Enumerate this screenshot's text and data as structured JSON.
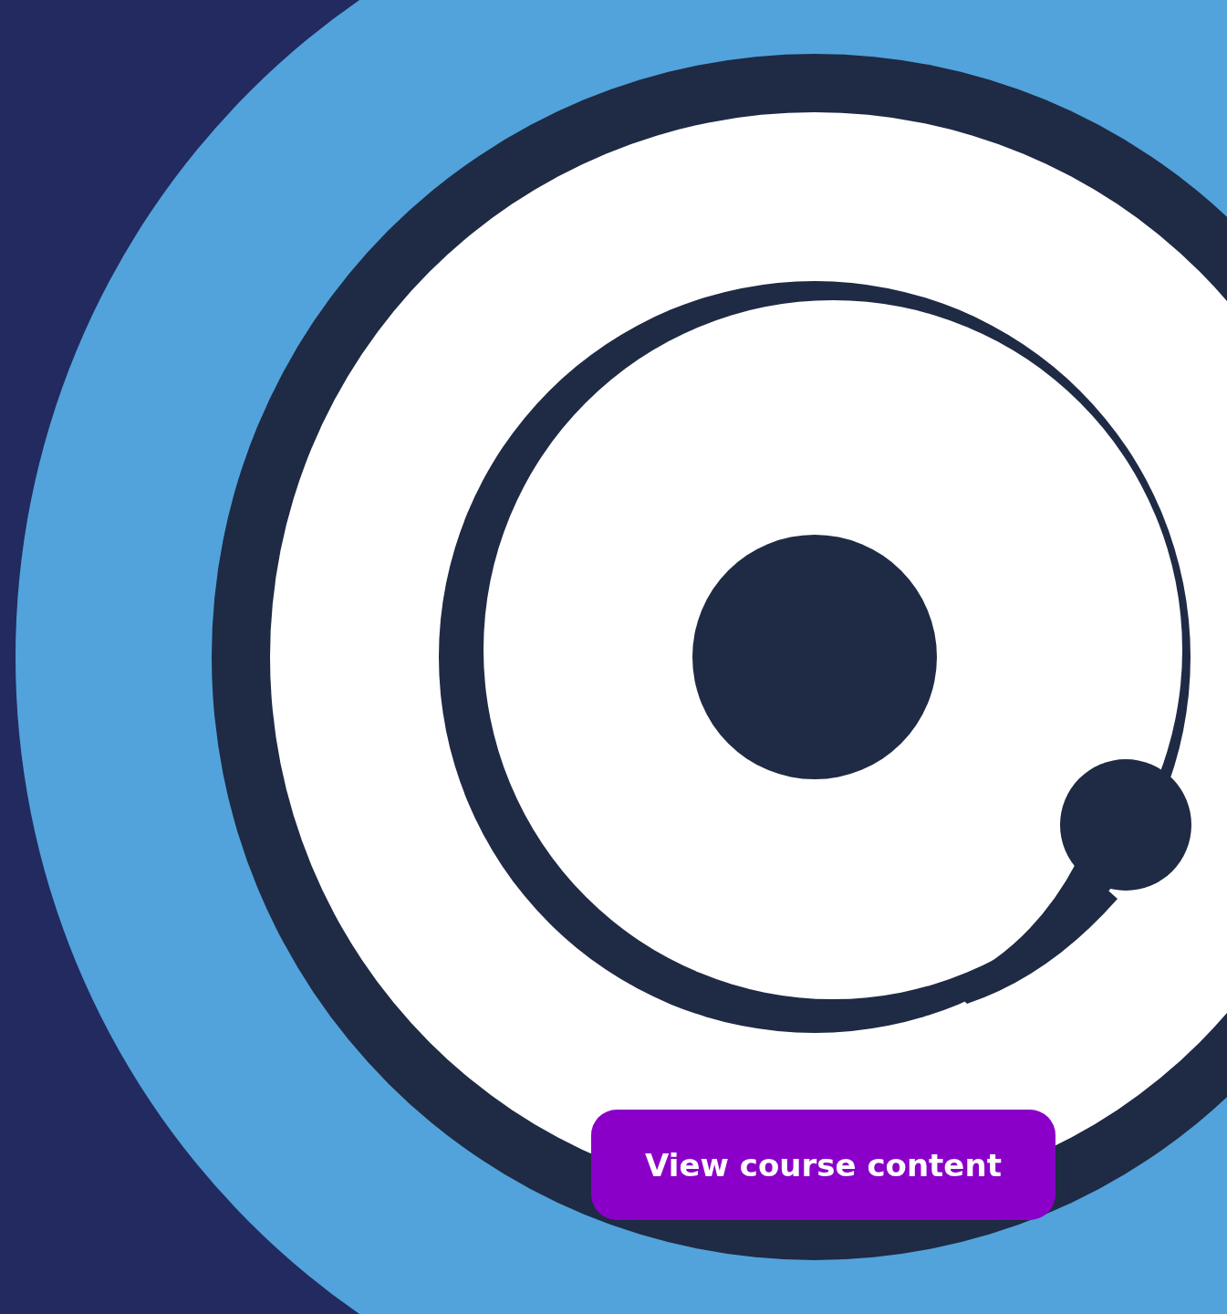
{
  "course_button": {
    "label": "View course content"
  }
}
